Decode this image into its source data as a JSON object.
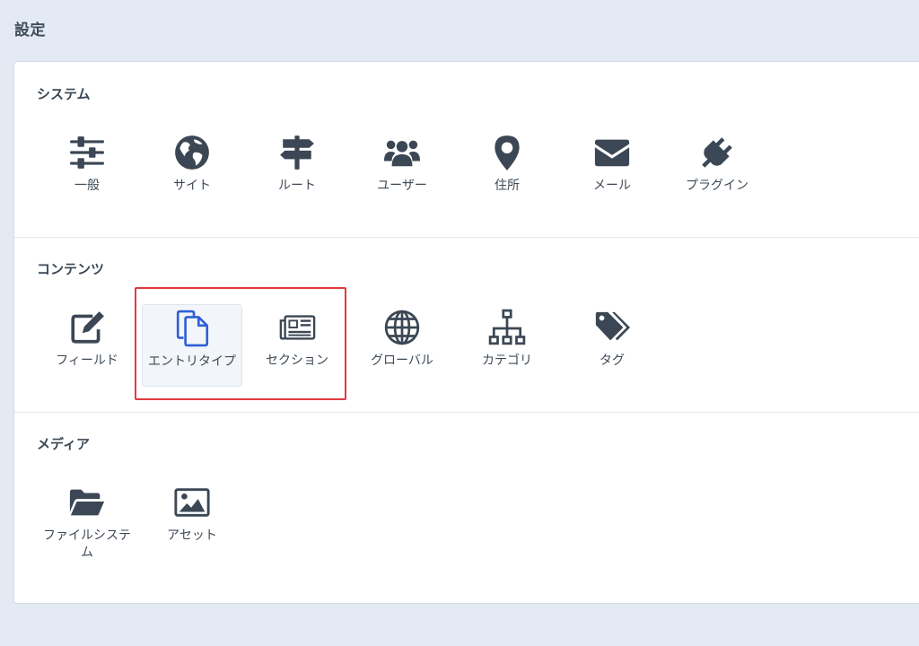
{
  "page": {
    "title": "設定"
  },
  "colors": {
    "icon": "#3b4754",
    "selected_icon": "#2f5fd6",
    "highlight": "#e23b3f"
  },
  "sections": [
    {
      "heading": "システム",
      "items": [
        {
          "label": "一般",
          "icon": "sliders-icon"
        },
        {
          "label": "サイト",
          "icon": "globe-icon"
        },
        {
          "label": "ルート",
          "icon": "signpost-icon"
        },
        {
          "label": "ユーザー",
          "icon": "users-icon"
        },
        {
          "label": "住所",
          "icon": "map-pin-icon"
        },
        {
          "label": "メール",
          "icon": "envelope-icon"
        },
        {
          "label": "プラグイン",
          "icon": "plug-icon"
        }
      ]
    },
    {
      "heading": "コンテンツ",
      "items": [
        {
          "label": "フィールド",
          "icon": "edit-icon"
        },
        {
          "label": "エントリタイプ",
          "icon": "copy-icon",
          "selected": true
        },
        {
          "label": "セクション",
          "icon": "newspaper-icon"
        },
        {
          "label": "グローバル",
          "icon": "world-grid-icon"
        },
        {
          "label": "カテゴリ",
          "icon": "sitemap-icon"
        },
        {
          "label": "タグ",
          "icon": "tags-icon"
        }
      ]
    },
    {
      "heading": "メディア",
      "items": [
        {
          "label": "ファイルシステム",
          "icon": "folder-open-icon"
        },
        {
          "label": "アセット",
          "icon": "image-icon"
        }
      ]
    }
  ]
}
